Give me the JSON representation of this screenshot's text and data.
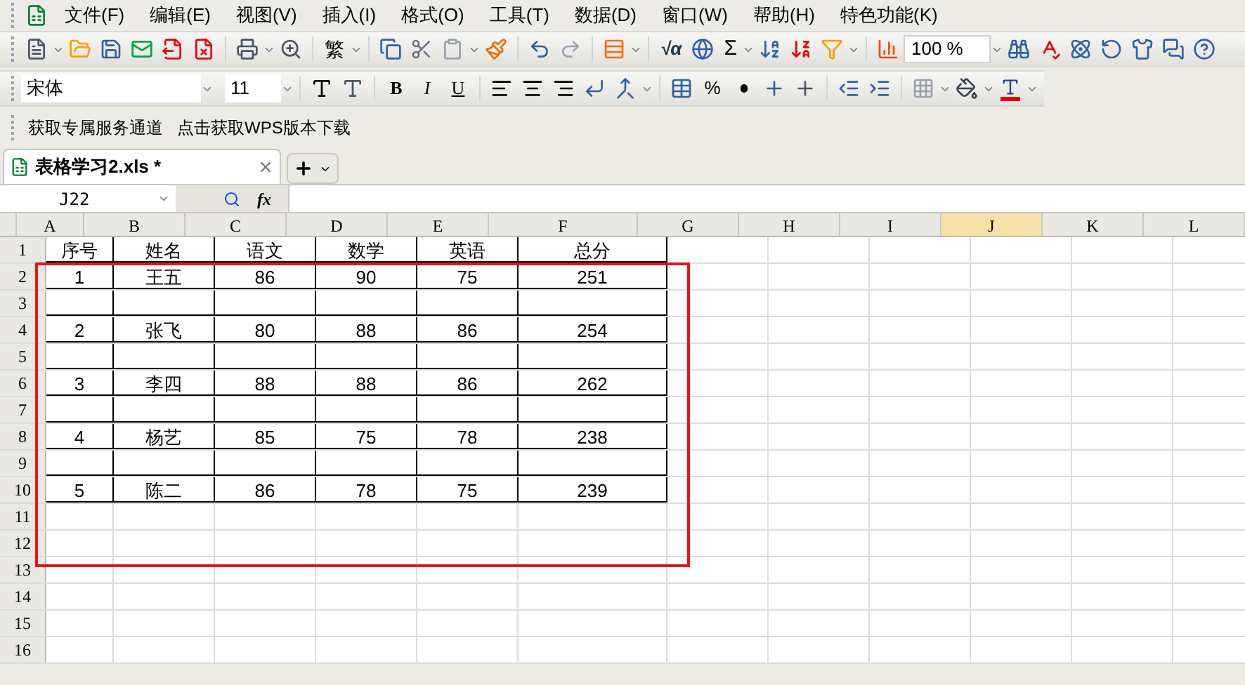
{
  "menu": [
    "文件(F)",
    "编辑(E)",
    "视图(V)",
    "插入(I)",
    "格式(O)",
    "工具(T)",
    "数据(D)",
    "窗口(W)",
    "帮助(H)",
    "特色功能(K)"
  ],
  "toolbar": {
    "traditional": "繁",
    "formula": "√α",
    "sum": "Σ",
    "zoom": "100 %"
  },
  "format_bar": {
    "font": "宋体",
    "size": "11",
    "styles": [
      "B",
      "I",
      "U"
    ],
    "percent": "%"
  },
  "links": [
    "获取专属服务通道",
    "点击获取WPS版本下载"
  ],
  "tabs": [
    {
      "title": "表格学习2.xls *",
      "selected": true
    }
  ],
  "formula_bar": {
    "name_box": "J22",
    "fx": "fx"
  },
  "columns": [
    {
      "label": "A",
      "selected": false
    },
    {
      "label": "B",
      "selected": false
    },
    {
      "label": "C",
      "selected": false
    },
    {
      "label": "D",
      "selected": false
    },
    {
      "label": "E",
      "selected": false
    },
    {
      "label": "F",
      "selected": false
    },
    {
      "label": "G",
      "selected": false
    },
    {
      "label": "H",
      "selected": false
    },
    {
      "label": "I",
      "selected": false
    },
    {
      "label": "J",
      "selected": true
    },
    {
      "label": "K",
      "selected": false
    },
    {
      "label": "L",
      "selected": false
    }
  ],
  "rows": [
    {
      "number": "1",
      "bordered": true,
      "cells": [
        "序号",
        "姓名",
        "语文",
        "数学",
        "英语",
        "总分"
      ]
    },
    {
      "number": "2",
      "bordered": true,
      "cells": [
        "1",
        "王五",
        "86",
        "90",
        "75",
        "251"
      ]
    },
    {
      "number": "3",
      "bordered": true
    },
    {
      "number": "4",
      "bordered": true,
      "cells": [
        "2",
        "张飞",
        "80",
        "88",
        "86",
        "254"
      ]
    },
    {
      "number": "5",
      "bordered": true
    },
    {
      "number": "6",
      "bordered": true,
      "cells": [
        "3",
        "李四",
        "88",
        "88",
        "86",
        "262"
      ]
    },
    {
      "number": "7",
      "bordered": true
    },
    {
      "number": "8",
      "bordered": true,
      "cells": [
        "4",
        "杨艺",
        "85",
        "75",
        "78",
        "238"
      ]
    },
    {
      "number": "9",
      "bordered": true
    },
    {
      "number": "10",
      "bordered": true,
      "cells": [
        "5",
        "陈二",
        "86",
        "78",
        "75",
        "239"
      ]
    },
    {
      "number": "11",
      "bordered": false
    },
    {
      "number": "12",
      "bordered": false
    },
    {
      "number": "13",
      "bordered": false
    },
    {
      "number": "14",
      "bordered": false
    },
    {
      "number": "15",
      "bordered": false
    },
    {
      "number": "16",
      "bordered": false
    }
  ]
}
